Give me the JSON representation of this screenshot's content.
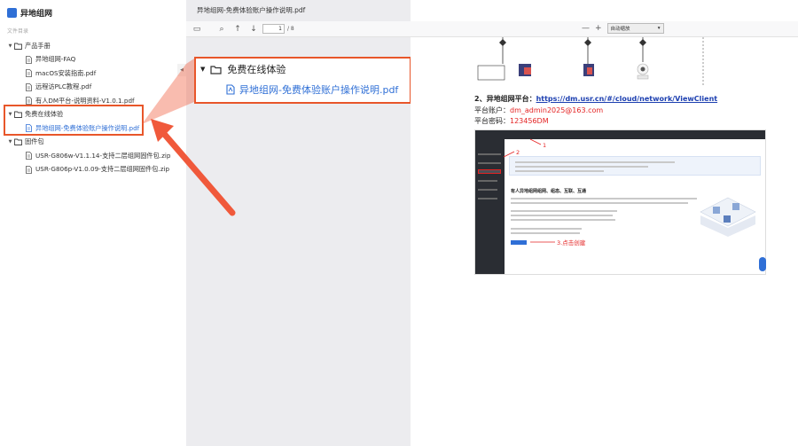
{
  "app": {
    "name": "异地组网"
  },
  "sidebar": {
    "dir_label": "文件目录",
    "tree": [
      {
        "label": "产品手册",
        "type": "folder",
        "level": 0
      },
      {
        "label": "异地组网-FAQ",
        "type": "file",
        "level": 1
      },
      {
        "label": "macOS安装指南.pdf",
        "type": "file",
        "level": 1
      },
      {
        "label": "远程访PLC教程.pdf",
        "type": "file",
        "level": 1
      },
      {
        "label": "有人DM平台-说明资料-V1.0.1.pdf",
        "type": "file",
        "level": 1
      },
      {
        "label": "免费在线体验",
        "type": "folder",
        "level": 0
      },
      {
        "label": "异地组网-免费体验账户操作说明.pdf",
        "type": "file",
        "level": 1,
        "active": true
      },
      {
        "label": "固件包",
        "type": "folder",
        "level": 0
      },
      {
        "label": "USR-G806w-V1.1.14-支持二层组网固件包.zip",
        "type": "file",
        "level": 1
      },
      {
        "label": "USR-G806p-V1.0.09-支持二层组网固件包.zip",
        "type": "file",
        "level": 1
      }
    ]
  },
  "viewer": {
    "title": "异地组网-免费体验账户操作说明.pdf",
    "page_current": "1",
    "page_total": "/ 8",
    "zoom_minus": "—",
    "zoom_plus": "+",
    "zoom_value": "自动缩放"
  },
  "callout": {
    "folder_label": "免费在线体验",
    "file_label": "异地组网-免费体验账户操作说明.pdf"
  },
  "document": {
    "section_label": "2、异地组网平台：",
    "link": "https://dm.usr.cn/#/cloud/network/ViewClient",
    "account_label": "平台账户：",
    "account_value": "dm_admin2025@163.com",
    "password_label": "平台密码：",
    "password_value": "123456DM",
    "shot_heading": "有人异地组网组网、组态、互联、互通",
    "shot_step1": "1",
    "shot_step2": "2",
    "shot_step3": "3.点击创建"
  },
  "colors": {
    "accent": "#2f6fd6",
    "highlight": "#e8562a"
  }
}
